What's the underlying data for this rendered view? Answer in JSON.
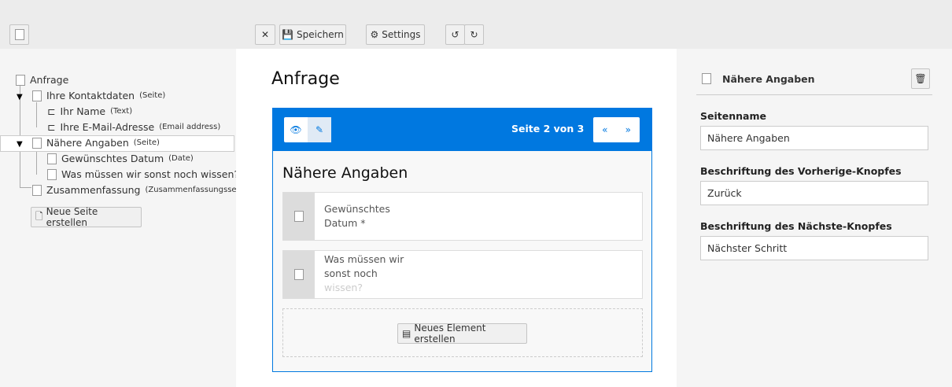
{
  "toolbar": {
    "close": "✕",
    "save": "Speichern",
    "settings": "Settings"
  },
  "tree": {
    "root": "Anfrage",
    "items": [
      {
        "label": "Ihre Kontaktdaten",
        "type": "(Seite)"
      },
      {
        "label": "Ihr Name",
        "type": "(Text)"
      },
      {
        "label": "Ihre E-Mail-Adresse",
        "type": "(Email address)"
      },
      {
        "label": "Nähere Angaben",
        "type": "(Seite)"
      },
      {
        "label": "Gewünschtes Datum",
        "type": "(Date)"
      },
      {
        "label": "Was müssen wir sonst noch wissen?",
        "type": ""
      },
      {
        "label": "Zusammenfassung",
        "type": "(Zusammenfassungsseite)"
      }
    ],
    "new_page": "Neue Seite erstellen"
  },
  "center": {
    "title": "Anfrage",
    "page_indicator": "Seite 2 von 3",
    "page_title": "Nähere Angaben",
    "elements": [
      {
        "l1": "Gewünschtes",
        "l2": "Datum *",
        "l3": ""
      },
      {
        "l1": "Was müssen wir",
        "l2": "sonst noch",
        "l3": "wissen?"
      }
    ],
    "new_element": "Neues Element erstellen"
  },
  "right": {
    "title": "Nähere Angaben",
    "fields": [
      {
        "label": "Seitenname",
        "value": "Nähere Angaben"
      },
      {
        "label": "Beschriftung des Vorherige-Knopfes",
        "value": "Zurück"
      },
      {
        "label": "Beschriftung des Nächste-Knopfes",
        "value": "Nächster Schritt"
      }
    ]
  }
}
